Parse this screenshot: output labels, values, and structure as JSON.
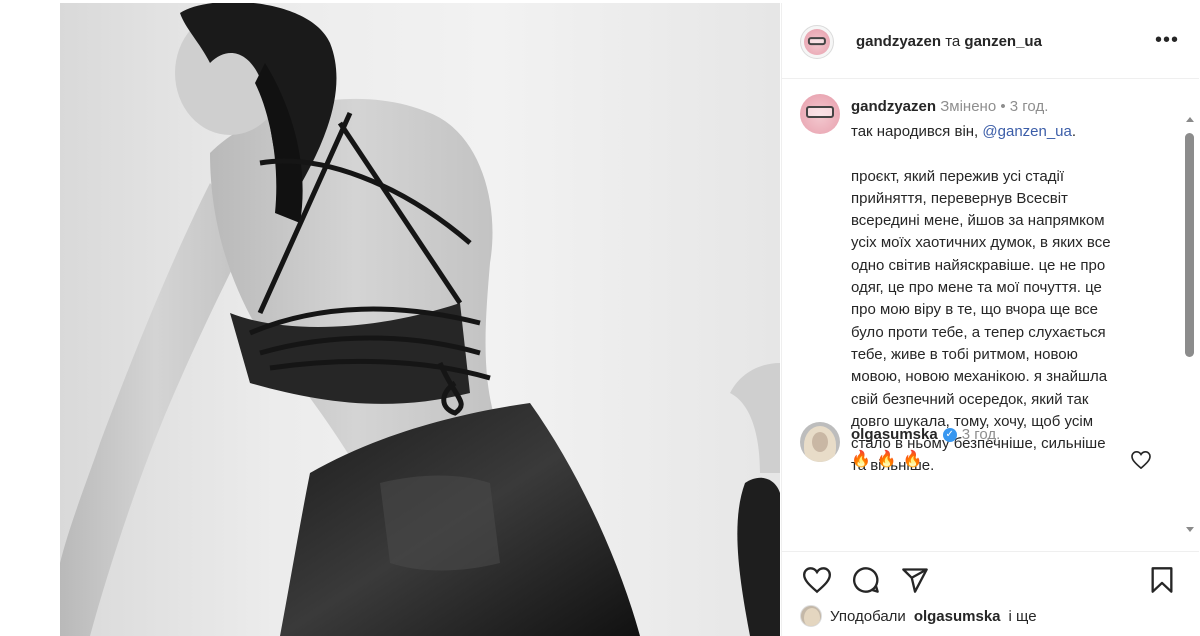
{
  "header": {
    "username": "gandzyazen",
    "connector": "та",
    "collaborator": "ganzen_ua",
    "more_icon": "more-horizontal-icon"
  },
  "caption": {
    "username": "gandzyazen",
    "edited_label": "Змінено",
    "bullet": "•",
    "time": "3 год.",
    "line1_prefix": "так народився він,",
    "mention": "@ganzen_ua",
    "line1_suffix": ".",
    "body": "проєкт, який пережив усі стадії\nприйняття, перевернув Всесвіт\nвсередині мене, йшов за напрямком\nусіх моїх хаотичних думок, в яких все\nодно світив найяскравіше. це не про\nодяг, це про мене та мої почуття. це\nпро мою віру в те, що вчора ще все\nбуло проти тебе, а тепер слухається\nтебе, живе в тобі ритмом, новою\nмовою, новою механікою. я знайшла\nсвій безпечний осередок, який так\nдовго шукала, тому, хочу, щоб усім\nстало в ньому безпечніше, сильніше\nта вільніше."
  },
  "comment": {
    "username": "olgasumska",
    "verified_icon": "verified-badge-icon",
    "verified_glyph": "✓",
    "time": "3 год.",
    "text": "🔥🔥🔥"
  },
  "likes": {
    "prefix": "Уподобали",
    "username": "olgasumska",
    "suffix": "і ще"
  },
  "colors": {
    "mention": "#3b5da8",
    "muted": "#8e8e8e",
    "verified": "#3897f0"
  }
}
